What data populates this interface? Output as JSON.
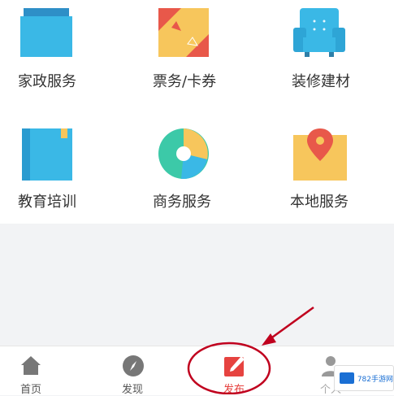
{
  "services": [
    {
      "label": "家政服务",
      "icon": "folder-icon"
    },
    {
      "label": "票务/卡券",
      "icon": "ticket-icon"
    },
    {
      "label": "装修建材",
      "icon": "sofa-icon"
    },
    {
      "label": "教育培训",
      "icon": "book-icon"
    },
    {
      "label": "商务服务",
      "icon": "pie-chart-icon"
    },
    {
      "label": "本地服务",
      "icon": "map-pin-icon"
    }
  ],
  "tabs": [
    {
      "label": "首页",
      "icon": "home-icon"
    },
    {
      "label": "发现",
      "icon": "compass-icon"
    },
    {
      "label": "发布",
      "icon": "edit-icon"
    },
    {
      "label": "个人",
      "icon": "person-icon"
    }
  ],
  "watermark": {
    "text": "782手游网"
  },
  "colors": {
    "accent": "#e64340",
    "annotation": "#c0001e"
  }
}
